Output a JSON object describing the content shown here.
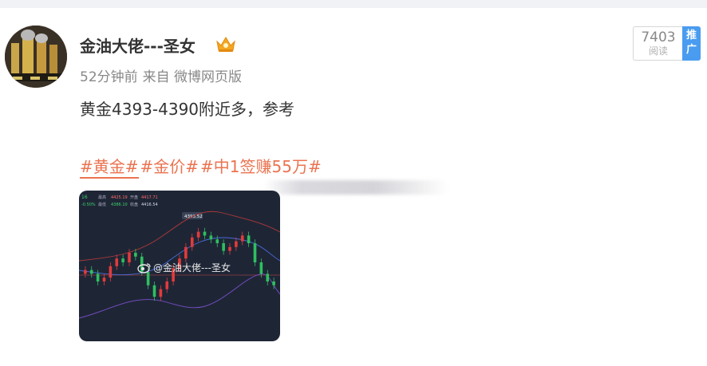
{
  "post": {
    "author": "金油大佬---圣女",
    "time": "52分钟前",
    "source": "来自 微博网页版",
    "reads": "7403",
    "reads_label": "阅读",
    "promo_line1": "推",
    "promo_line2": "广",
    "content": "黄金4393-4390附近多，参考",
    "topics": [
      "#黄金#",
      "#金价#",
      "#中1签赚55万#"
    ]
  },
  "image": {
    "watermark": "@金油大佬---圣女",
    "chart_header": {
      "row1": [
        "16",
        "最高",
        "4425.19",
        "开盘",
        "4417.71"
      ],
      "row2": [
        "-0.50%",
        "最低",
        "4386.10",
        "收盘",
        "4416.54"
      ],
      "callout": "4393.52"
    }
  },
  "colors": {
    "topic": "#eb7350",
    "promo_bg": "#4a9cf0",
    "chart_bg": "#1e2636",
    "candle_up": "#e23b3b",
    "candle_down": "#2fbf5f"
  },
  "chart_data": {
    "type": "candlestick",
    "series": [
      {
        "name": "candles",
        "values": [
          4406,
          4404,
          4400,
          4402,
          4408,
          4412,
          4410,
          4415,
          4413,
          4405,
          4398,
          4392,
          4396,
          4400,
          4407,
          4412,
          4418,
          4423,
          4426,
          4424,
          4422,
          4420,
          4416,
          4418,
          4421,
          4424,
          4420,
          4410,
          4404,
          4400,
          4398
        ]
      }
    ]
  }
}
